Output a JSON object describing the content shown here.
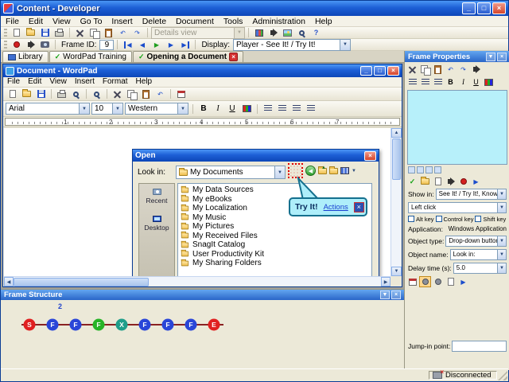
{
  "window": {
    "title": "Content - Developer"
  },
  "icons": {
    "dropdown": "▼",
    "up": "▲",
    "down": "▼",
    "left": "◀",
    "right": "▶",
    "close": "×",
    "minimize": "_",
    "maximize": "□",
    "check": "✓",
    "undo": "↶",
    "redo": "↷",
    "help": "?"
  },
  "menubar": {
    "items": [
      "File",
      "Edit",
      "View",
      "Go To",
      "Insert",
      "Delete",
      "Document",
      "Tools",
      "Administration",
      "Help"
    ]
  },
  "toolbar": {
    "details_view": "Details view",
    "frame_id_label": "Frame ID:",
    "frame_id_value": "9",
    "display_label": "Display:",
    "display_value": "Player - See It! / Try It!"
  },
  "tabs": {
    "library": "Library",
    "wordpad_training": "WordPad Training",
    "opening_document": "Opening a Document"
  },
  "wordpad": {
    "title": "Document - WordPad",
    "menu": [
      "File",
      "Edit",
      "View",
      "Insert",
      "Format",
      "Help"
    ],
    "font_name": "Arial",
    "font_size": "10",
    "script": "Western",
    "ruler": [
      "1",
      "2",
      "3",
      "4",
      "5",
      "6",
      "7"
    ]
  },
  "open_dialog": {
    "title": "Open",
    "look_in_label": "Look in:",
    "look_in_value": "My Documents",
    "places": [
      "Recent",
      "Desktop"
    ],
    "files": [
      "My Data Sources",
      "My eBooks",
      "My Localization",
      "My Music",
      "My Pictures",
      "My Received Files",
      "SnagIt Catalog",
      "User Productivity Kit",
      "My Sharing Folders"
    ]
  },
  "callout": {
    "title": "Try It!",
    "action_link": "Actions",
    "bubble_color": "#aeeefa",
    "border_color": "#15708e"
  },
  "frame_properties": {
    "title": "Frame Properties",
    "preview_color": "#b7f0fa",
    "show_in_label": "Show in:",
    "show_in_value": "See It! / Try It!, Know It?, Do It!",
    "click_type": "Left click",
    "alt_key_label": "Alt key",
    "control_key_label": "Control key",
    "shift_key_label": "Shift key",
    "application_label": "Application:",
    "application_value": "Windows Application",
    "object_type_label": "Object type:",
    "object_type_value": "Drop-down button",
    "object_name_label": "Object name:",
    "object_name_value": "Look in:",
    "delay_label": "Delay time (s):",
    "delay_value": "5.0",
    "jump_in_label": "Jump-in point:"
  },
  "frame_structure": {
    "title": "Frame Structure",
    "badge": "2",
    "line_color": "#8a2222",
    "nodes": [
      {
        "label": "S",
        "color": "#e02020"
      },
      {
        "label": "F",
        "color": "#2a46d8"
      },
      {
        "label": "F",
        "color": "#2a46d8"
      },
      {
        "label": "F",
        "color": "#27b427"
      },
      {
        "label": "X",
        "color": "#1f9e8a"
      },
      {
        "label": "F",
        "color": "#2a46d8"
      },
      {
        "label": "F",
        "color": "#2a46d8"
      },
      {
        "label": "F",
        "color": "#2a46d8"
      },
      {
        "label": "E",
        "color": "#e02020"
      }
    ]
  },
  "statusbar": {
    "status": "Disconnected"
  }
}
